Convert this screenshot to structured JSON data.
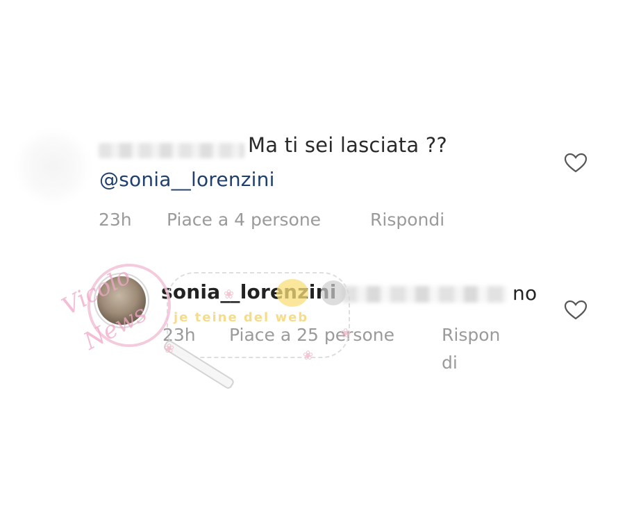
{
  "comments": [
    {
      "text": "Ma ti sei lasciata ??",
      "mention": "@sonia__lorenzini",
      "time": "23h",
      "likes": "Piace a 4 persone",
      "reply": "Rispondi"
    },
    {
      "username": "sonia__lorenzini",
      "text_tail": "no",
      "time": "23h",
      "likes": "Piace a 25 persone",
      "reply_line1": "Rispon",
      "reply_line2": "di"
    }
  ],
  "watermark": {
    "script_line1": "Vicolo",
    "script_line2": "News",
    "banner": "je teine del web"
  },
  "icons": {
    "like": "heart-outline-icon",
    "paw": "paw-icon"
  },
  "colors": {
    "text": "#2a2a2a",
    "mention": "#1f3f6e",
    "meta": "#9a9a9a",
    "watermark_pink": "#f0a9c8",
    "watermark_yellow": "#f5d46e"
  }
}
